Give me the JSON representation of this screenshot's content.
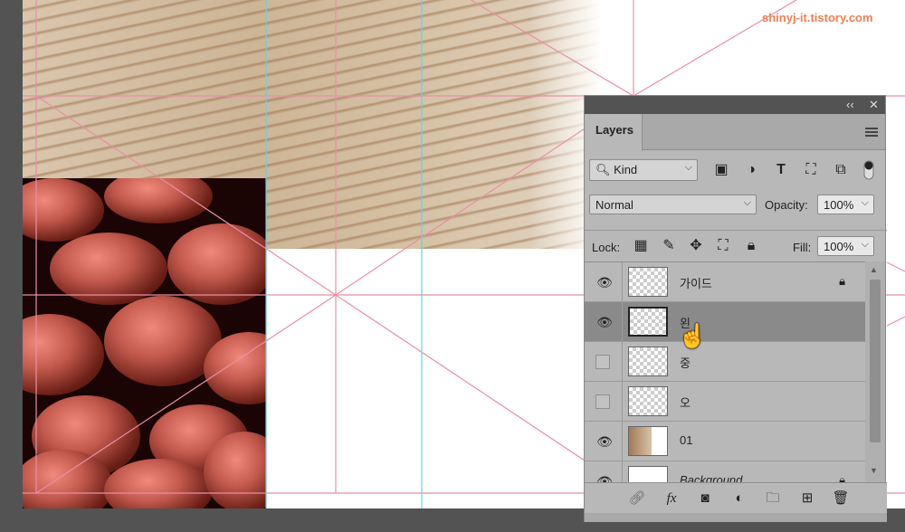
{
  "watermark": "shinyj-it.tistory.com",
  "panel": {
    "collapse_label": "‹‹",
    "close_label": "✕",
    "tab": "Layers",
    "filter": {
      "kind_label": "Kind"
    },
    "blend_mode": "Normal",
    "opacity_label": "Opacity:",
    "opacity_value": "100%",
    "lock_label": "Lock:",
    "fill_label": "Fill:",
    "fill_value": "100%",
    "layers": [
      {
        "name": "가이드",
        "visible": true,
        "locked": true,
        "selected": false
      },
      {
        "name": "왼",
        "visible": true,
        "locked": false,
        "selected": true
      },
      {
        "name": "중",
        "visible": false,
        "locked": false,
        "selected": false
      },
      {
        "name": "오",
        "visible": false,
        "locked": false,
        "selected": false
      },
      {
        "name": "01",
        "visible": true,
        "locked": false,
        "selected": false
      },
      {
        "name": "Background",
        "visible": true,
        "locked": true,
        "selected": false
      }
    ]
  },
  "colors": {
    "guide_cyan": "#5fd6e0",
    "guide_pink": "#e88fa5",
    "watermark": "#f07f52"
  }
}
